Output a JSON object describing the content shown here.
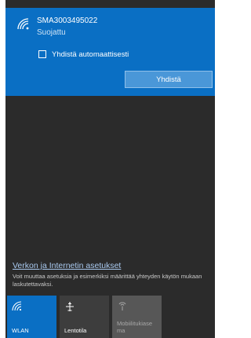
{
  "network": {
    "ssid": "SMA3003495022",
    "status": "Suojattu",
    "auto_connect_label": "Yhdistä automaattisesti",
    "auto_connect_checked": false,
    "connect_button": "Yhdistä",
    "icon": "wifi-icon"
  },
  "footer": {
    "settings_link": "Verkon ja Internetin asetukset",
    "settings_description": "Voit muuttaa asetuksia ja esimerkiksi määrittää yhteyden käytön mukaan laskutettavaksi."
  },
  "quick_actions": [
    {
      "label": "WLAN",
      "icon": "wifi-icon",
      "active": true
    },
    {
      "label": "Lentotila",
      "icon": "airplane-icon",
      "active": false
    },
    {
      "label": "Mobiilitukiase ma",
      "icon": "mobile-hotspot-icon",
      "active": false,
      "disabled": true
    }
  ],
  "colors": {
    "accent": "#0a6fc4",
    "panel_background": "#2b2b2b",
    "link": "#a9c9ef"
  }
}
